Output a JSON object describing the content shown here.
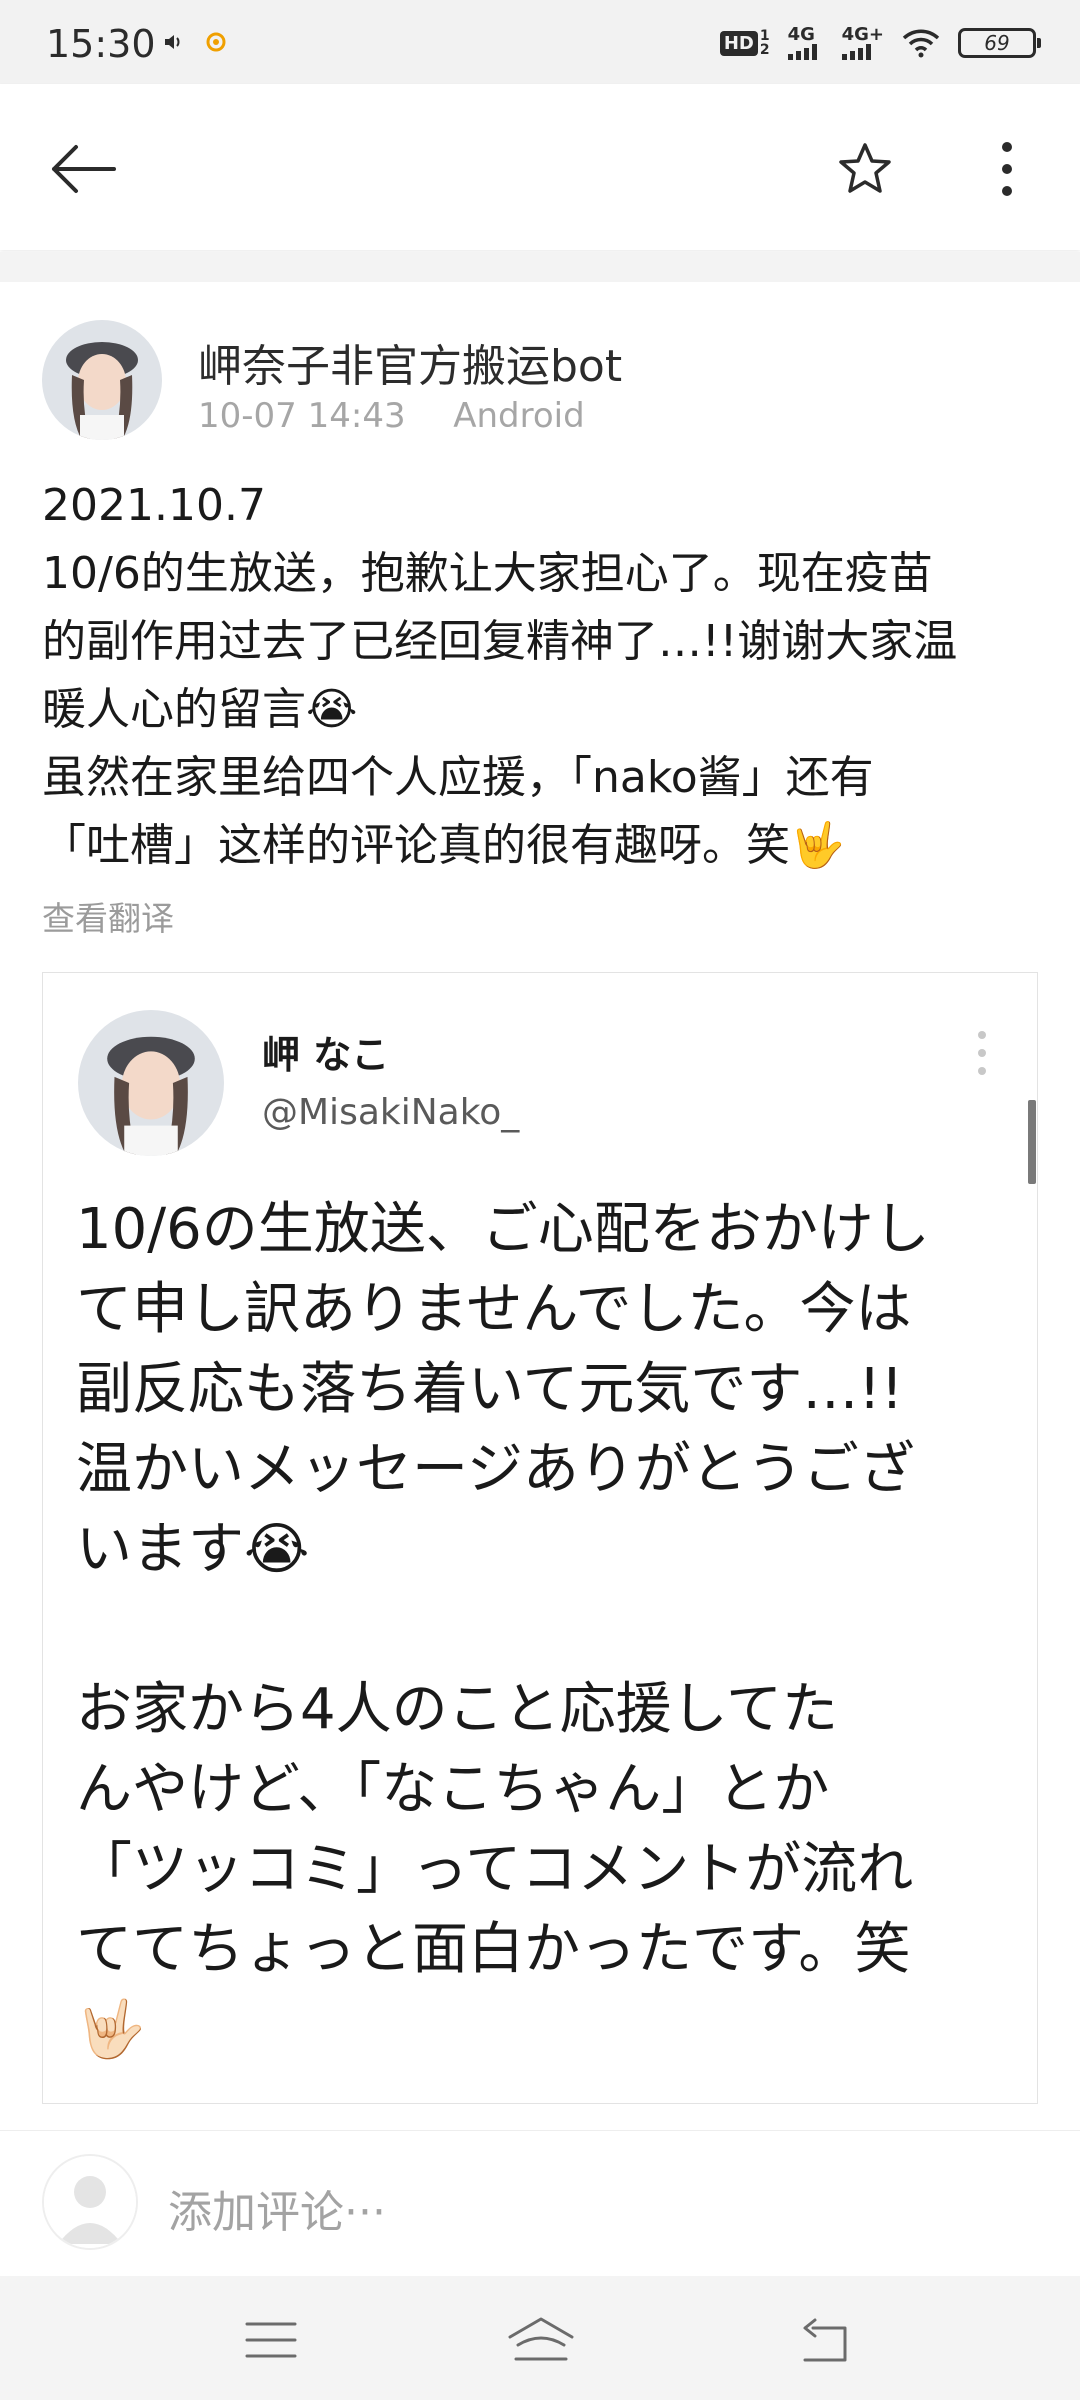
{
  "status_bar": {
    "time": "15:30",
    "left_icons": [
      "volume-icon",
      "app-notification-icon"
    ],
    "network_1": "4G",
    "network_2": "4G+",
    "hd_label": "HD",
    "battery_level": "69"
  },
  "toolbar": {
    "icons": [
      "back-arrow-icon",
      "star-icon",
      "more-vertical-icon"
    ]
  },
  "post": {
    "author": "岬奈子非官方搬运bot",
    "timestamp": "10-07 14:43",
    "source": "Android",
    "lines": [
      "2021.10.7",
      "10/6的生放送，抱歉让大家担心了。现在疫苗",
      "的副作用过去了已经回复精神了…!!谢谢大家温",
      "暖人心的留言😭",
      "虽然在家里给四个人应援，「nako酱」还有",
      "「吐槽」这样的评论真的很有趣呀。笑🤟"
    ],
    "translate_label": "查看翻译"
  },
  "embedded_tweet": {
    "name": "岬 なこ",
    "handle": "@MisakiNako_",
    "lines": [
      "10/6の生放送、ご心配をおかけし",
      "て申し訳ありませんでした。今は",
      "副反応も落ち着いて元気です…!!",
      "温かいメッセージありがとうござ",
      "います😭",
      "",
      "お家から4人のこと応援してた",
      "んやけど、「なこちゃん」とか",
      "「ツッコミ」ってコメントが流れ",
      "ててちょっと面白かったです。笑",
      "🤟🏻"
    ]
  },
  "comment": {
    "placeholder": "添加评论···"
  },
  "nav_bar": {
    "icons": [
      "menu-icon",
      "home-icon",
      "back-icon"
    ]
  },
  "colors": {
    "status_bg": "#f2f2f2",
    "meta_gray": "#a6a6a6",
    "nav_bg": "#f4f4f4"
  }
}
